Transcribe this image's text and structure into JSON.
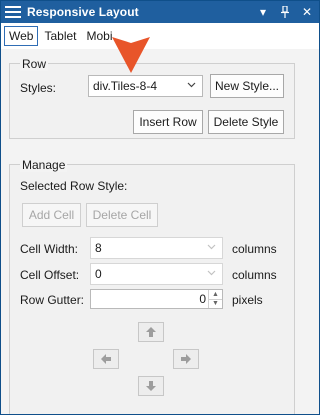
{
  "window": {
    "title": "Responsive Layout",
    "controls": {
      "dropdown_glyph": "▾",
      "pin_glyph": "⊥",
      "close_glyph": "✕"
    }
  },
  "tabs": [
    {
      "label": "Web",
      "active": true
    },
    {
      "label": "Tablet",
      "active": false
    },
    {
      "label": "Mobi",
      "active": false
    }
  ],
  "row_group": {
    "title": "Row",
    "styles_label": "Styles:",
    "styles_value": "div.Tiles-8-4",
    "new_style_button": "New Style...",
    "insert_row_button": "Insert Row",
    "delete_style_button": "Delete Style"
  },
  "manage_group": {
    "title": "Manage",
    "selected_row_style_label": "Selected Row Style:",
    "add_cell_button": "Add Cell",
    "delete_cell_button": "Delete Cell",
    "cell_width_label": "Cell Width:",
    "cell_width_value": "8",
    "cell_width_unit": "columns",
    "cell_offset_label": "Cell Offset:",
    "cell_offset_value": "0",
    "cell_offset_unit": "columns",
    "row_gutter_label": "Row Gutter:",
    "row_gutter_value": "0",
    "row_gutter_unit": "pixels"
  },
  "colors": {
    "titlebar": "#1f5f9f",
    "pointer": "#e8552a",
    "tab_active_border": "#2f6db5"
  },
  "icons": {
    "menu": "menu-icon",
    "up": "arrow-up-icon",
    "left": "arrow-left-icon",
    "right": "arrow-right-icon",
    "down": "arrow-down-icon",
    "pointer": "pointer-arrow-icon"
  }
}
